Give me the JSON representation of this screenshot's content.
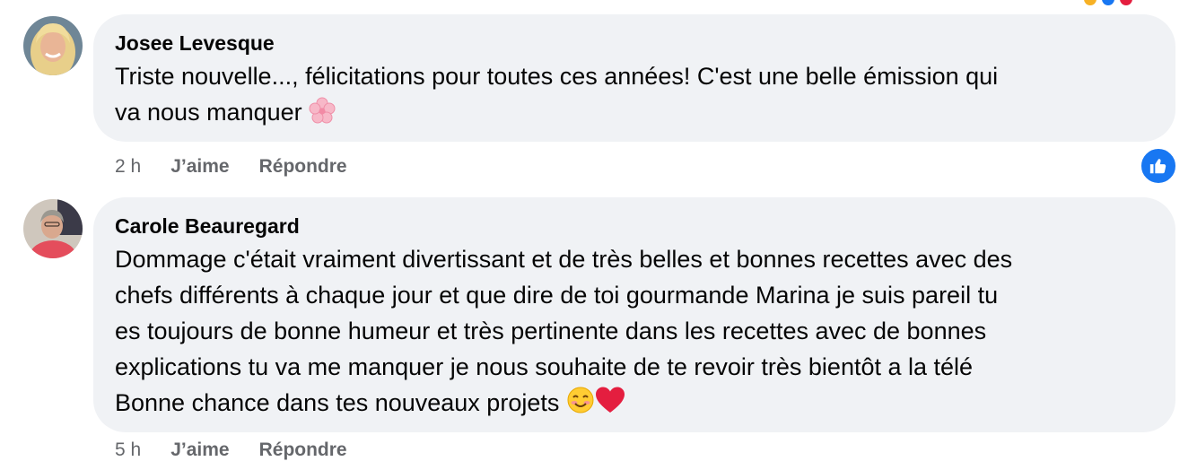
{
  "comments": [
    {
      "author": "Josee Levesque",
      "text": "Triste nouvelle..., félicitations pour toutes ces années! C'est une belle émission qui\nva nous manquer",
      "emoji": [
        "cherry-blossom"
      ],
      "time": "2 h",
      "like_label": "J’aime",
      "reply_label": "Répondre",
      "reaction": "like"
    },
    {
      "author": "Carole Beauregard",
      "text": "Dommage c'était vraiment divertissant et de très belles et bonnes recettes avec des\nchefs différents à chaque jour et que dire de toi gourmande Marina je suis pareil tu\nes toujours de bonne humeur et très pertinente dans les recettes avec de bonnes\nexplications tu va me manquer je nous souhaite de te revoir très bientôt a la télé\nBonne chance dans tes nouveaux projets",
      "emoji": [
        "smiling-face",
        "red-heart"
      ],
      "time": "5 h",
      "like_label": "J’aime",
      "reply_label": "Répondre"
    }
  ],
  "colors": {
    "bubble": "#f0f2f5",
    "meta": "#65676b",
    "accent": "#1877f2",
    "heart": "#e41e3f"
  }
}
